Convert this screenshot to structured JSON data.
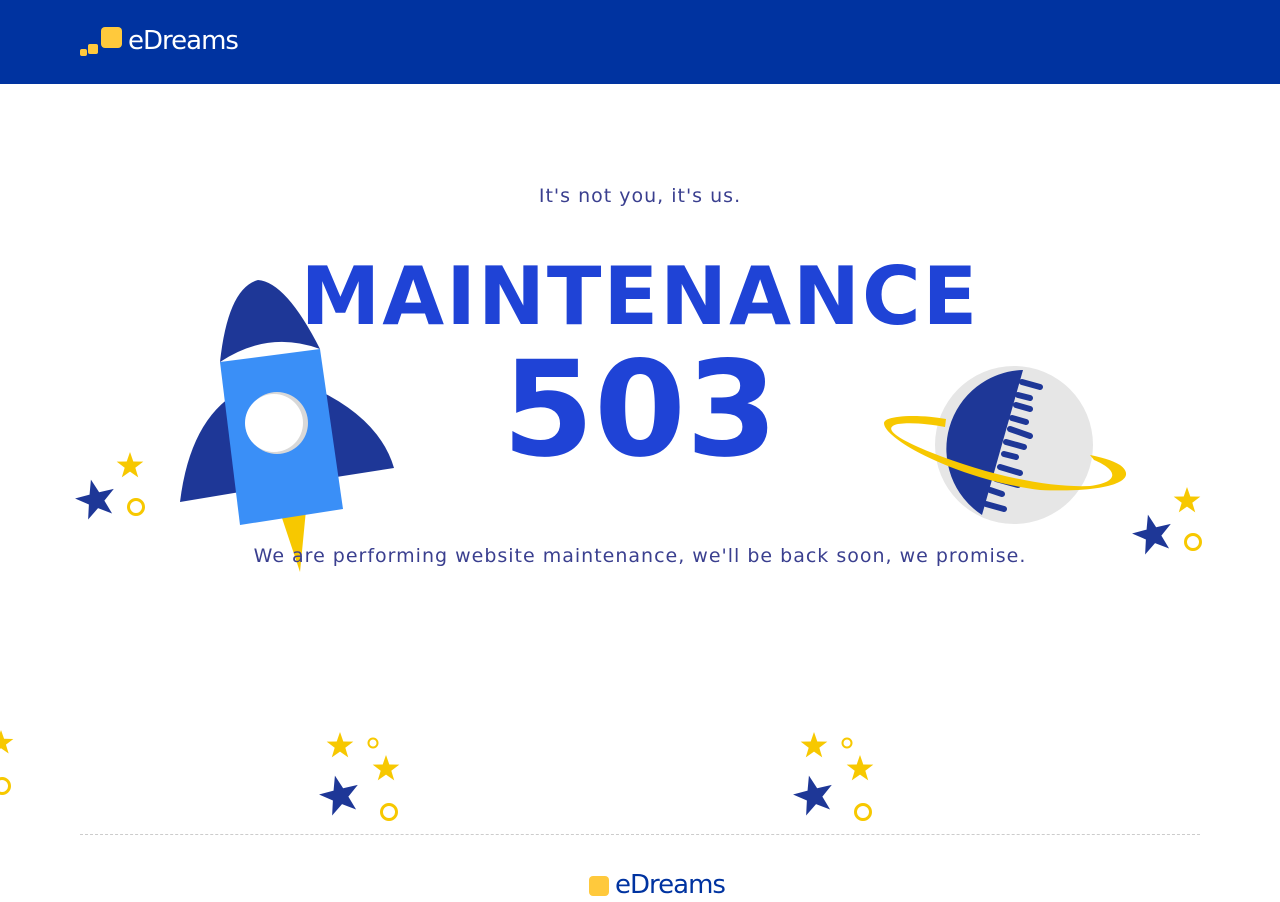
{
  "header": {
    "logo_text": "eDreams"
  },
  "main": {
    "tagline": "It's not you, it's us.",
    "title": "MAINTENANCE",
    "code": "503",
    "message": "We are performing website maintenance, we'll be back soon, we promise."
  },
  "footer": {
    "logo_text": "eDreams"
  },
  "colors": {
    "header_bg": "#0033a0",
    "brand_yellow": "#ffc93c",
    "title_blue": "#1f43d6",
    "text_blue": "#3a3f8f",
    "star_dark": "#1e3797",
    "star_yellow": "#f7c800",
    "rocket_body": "#3a8ff7",
    "planet_dark": "#1e3797",
    "planet_light": "#e6e6e6"
  },
  "illustrations": {
    "rocket": "rocket-icon",
    "planet": "planet-icon",
    "stars": "star-icon"
  }
}
